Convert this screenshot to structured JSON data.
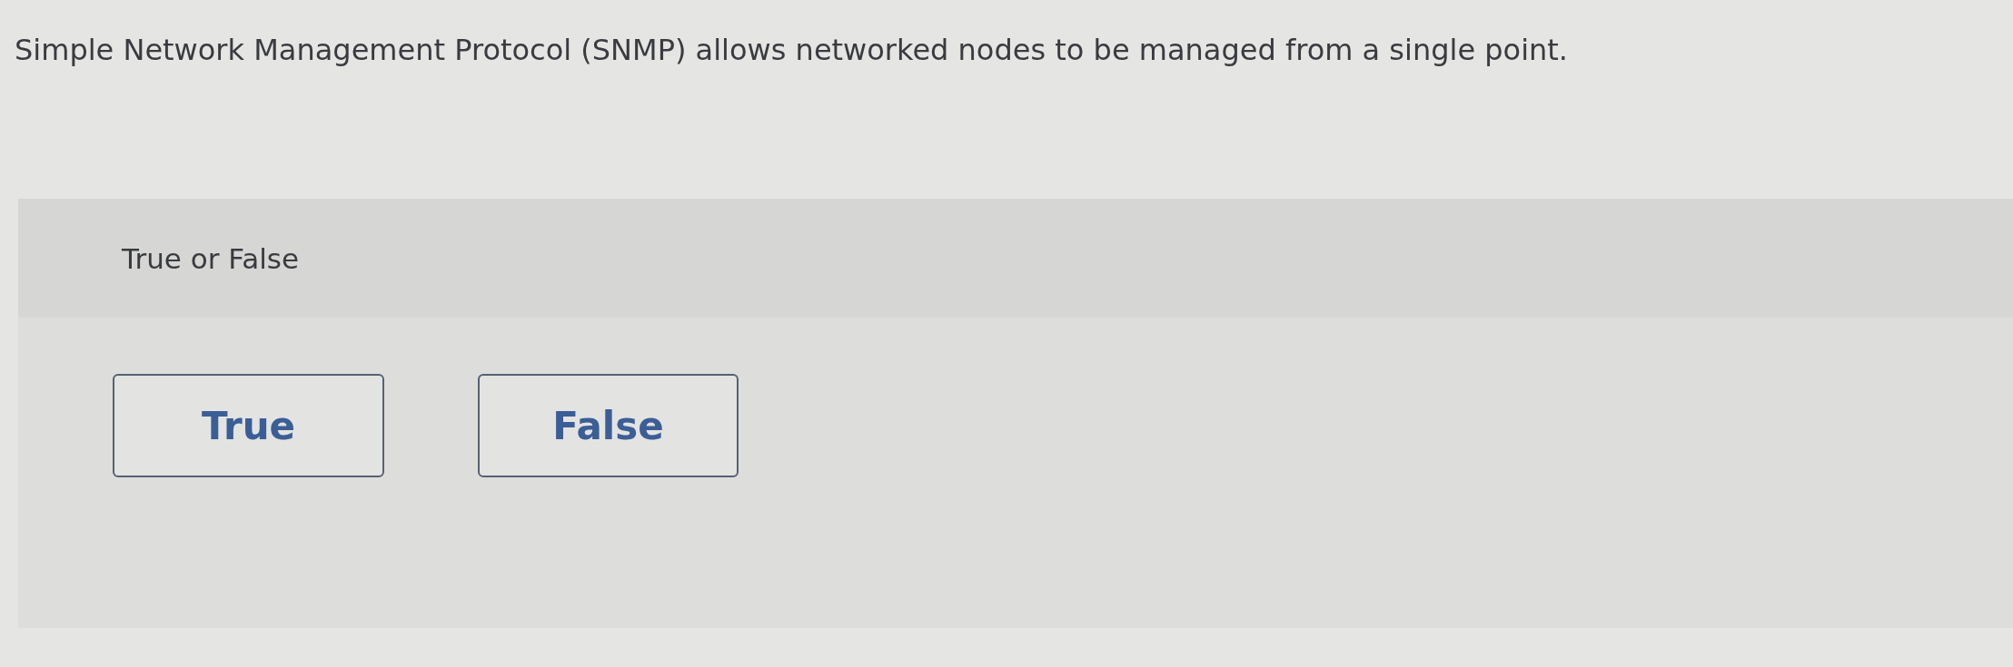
{
  "question": {
    "text": "Simple Network Management Protocol (SNMP) allows networked nodes to be managed from a single point."
  },
  "answer_panel": {
    "instruction": "True or False",
    "options": [
      {
        "label": "True",
        "selected": false
      },
      {
        "label": "False",
        "selected": false
      }
    ]
  }
}
